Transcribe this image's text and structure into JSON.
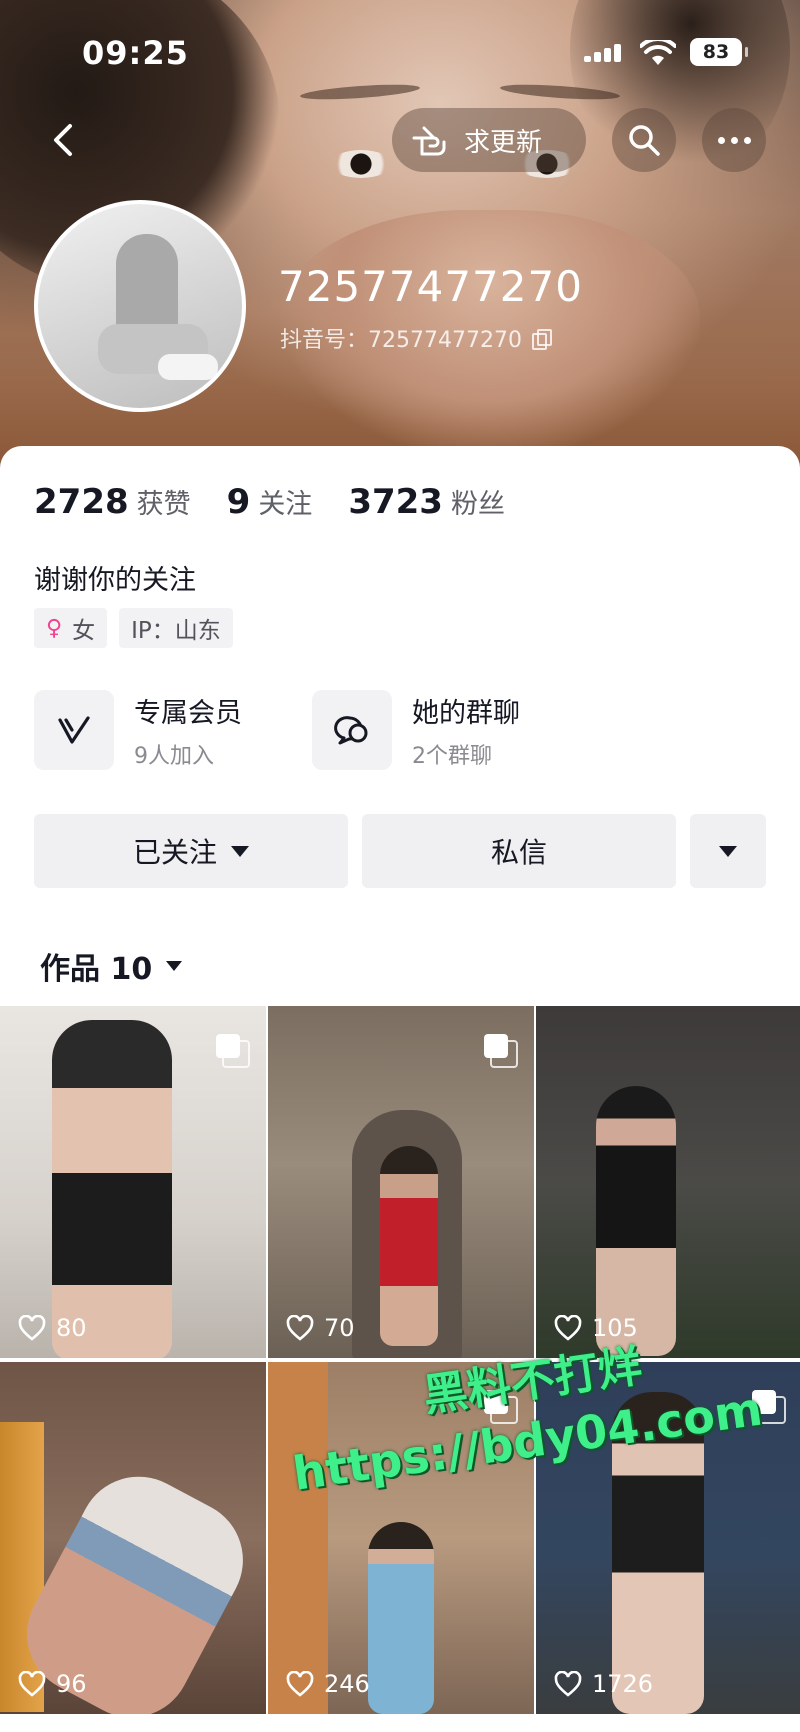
{
  "status_bar": {
    "time": "09:25",
    "battery": "83"
  },
  "header": {
    "update_label": "求更新"
  },
  "profile": {
    "nickname": "72577477270",
    "douyin_id": "抖音号：72577477270",
    "stats": [
      {
        "value": "2728",
        "label": "获赞"
      },
      {
        "value": "9",
        "label": "关注"
      },
      {
        "value": "3723",
        "label": "粉丝"
      }
    ],
    "bio": "谢谢你的关注",
    "tags": {
      "gender": "女",
      "ip": "IP：山东"
    }
  },
  "features": {
    "vip": {
      "title": "专属会员",
      "subtitle": "9人加入"
    },
    "group": {
      "title": "她的群聊",
      "subtitle": "2个群聊"
    }
  },
  "actions": {
    "follow": "已关注",
    "message": "私信"
  },
  "works_tab": {
    "label": "作品 10"
  },
  "works": [
    {
      "likes": "80",
      "multi": true
    },
    {
      "likes": "70",
      "multi": true
    },
    {
      "likes": "105",
      "multi": false
    },
    {
      "likes": "96",
      "multi": false
    },
    {
      "likes": "246",
      "multi": true
    },
    {
      "likes": "1726",
      "multi": true
    }
  ],
  "watermark": {
    "line1": "黑料不打烊",
    "line2": "https://bdy04.com"
  },
  "colors": {
    "female": "#f0448f",
    "watermark": "#3ff08a"
  }
}
